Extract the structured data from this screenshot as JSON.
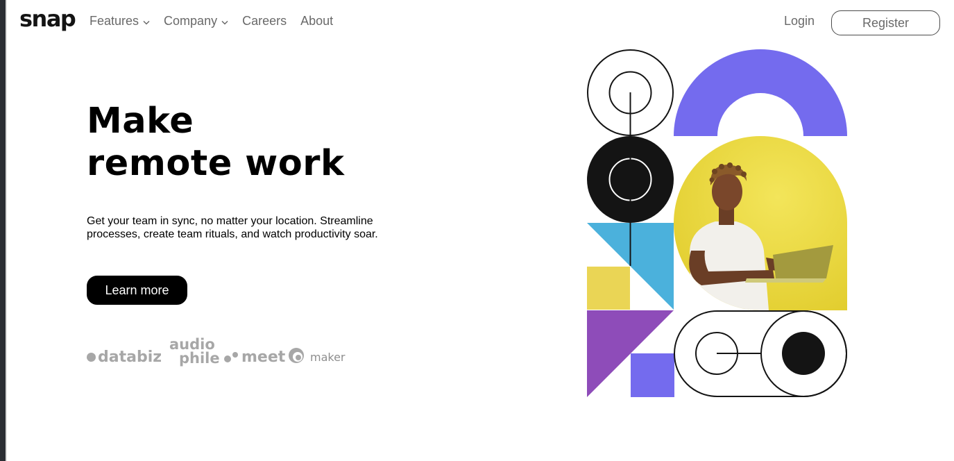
{
  "logo": "snap",
  "nav": {
    "features": "Features",
    "company": "Company",
    "careers": "Careers",
    "about": "About"
  },
  "auth": {
    "login": "Login",
    "register": "Register"
  },
  "hero": {
    "title_line1": "Make",
    "title_line2": "remote work",
    "text": "Get your team in sync, no matter your location. Streamline processes, create team rituals, and watch productivity soar.",
    "cta": "Learn more"
  },
  "clients": {
    "databiz": "databiz",
    "audiophile_top": "audio",
    "audiophile_bottom": "phile",
    "meet": "meet",
    "maker": "maker"
  },
  "colors": {
    "purple": "#746bee",
    "violet": "#8e4cb9",
    "cyan": "#4bb1dc",
    "yellow": "#ead555",
    "dark": "#141414",
    "gray_text": "#696969",
    "logo_gray": "#a7a7a7"
  }
}
